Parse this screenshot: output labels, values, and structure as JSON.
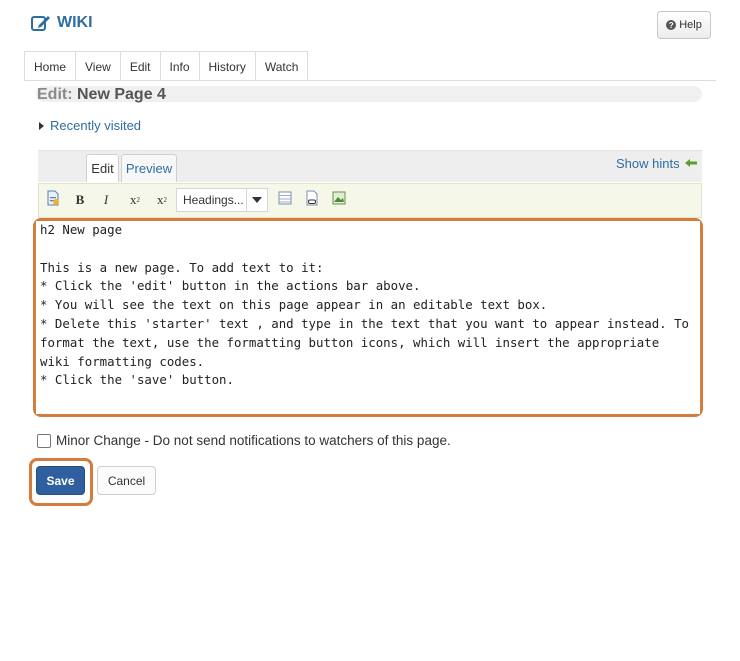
{
  "header": {
    "wiki_label": "WIKI",
    "help_label": "Help"
  },
  "nav": {
    "tabs": [
      "Home",
      "View",
      "Edit",
      "Info",
      "History",
      "Watch"
    ]
  },
  "page": {
    "title_prefix": "Edit:",
    "title": "New Page 4",
    "recently_visited": "Recently visited"
  },
  "editor": {
    "tabs": [
      "Edit",
      "Preview"
    ],
    "show_hints": "Show hints",
    "toolbar": {
      "bold": "B",
      "italic": "I",
      "superscript": "x",
      "subscript": "x",
      "headings": "Headings..."
    },
    "content": "h2 New page\n\nThis is a new page. To add text to it:\n* Click the 'edit' button in the actions bar above.\n* You will see the text on this page appear in an editable text box.\n* Delete this 'starter' text , and type in the text that you want to appear instead. To\nformat the text, use the formatting button icons, which will insert the appropriate\nwiki formatting codes.\n* Click the 'save' button."
  },
  "form": {
    "minor_change_label": "Minor Change - Do not send notifications to watchers of this page.",
    "save_label": "Save",
    "cancel_label": "Cancel"
  },
  "colors": {
    "accent": "#2e6da4",
    "highlight": "#d57b3c",
    "save_bg": "#2f5f9f"
  }
}
